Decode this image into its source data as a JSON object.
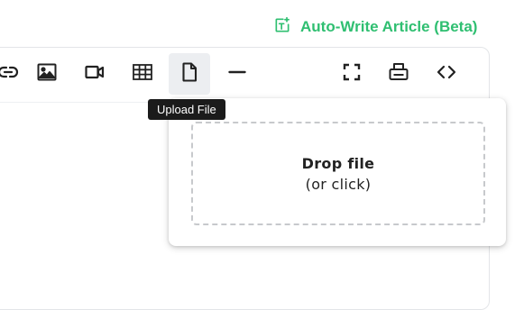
{
  "header": {
    "autowrite_label": "Auto-Write Article (Beta)",
    "accent_color": "#2fbf71"
  },
  "toolbar": {
    "buttons": [
      {
        "name": "link-icon",
        "active": false
      },
      {
        "name": "image-icon",
        "active": false
      },
      {
        "name": "video-icon",
        "active": false
      },
      {
        "name": "table-icon",
        "active": false
      },
      {
        "name": "file-icon",
        "active": true
      },
      {
        "name": "horizontal-rule-icon",
        "active": false
      },
      {
        "name": "fullscreen-icon",
        "active": false
      },
      {
        "name": "print-icon",
        "active": false
      },
      {
        "name": "code-view-icon",
        "active": false
      }
    ],
    "tooltip": "Upload File"
  },
  "upload_popover": {
    "drop_title": "Drop file",
    "drop_subtitle": "(or click)"
  }
}
